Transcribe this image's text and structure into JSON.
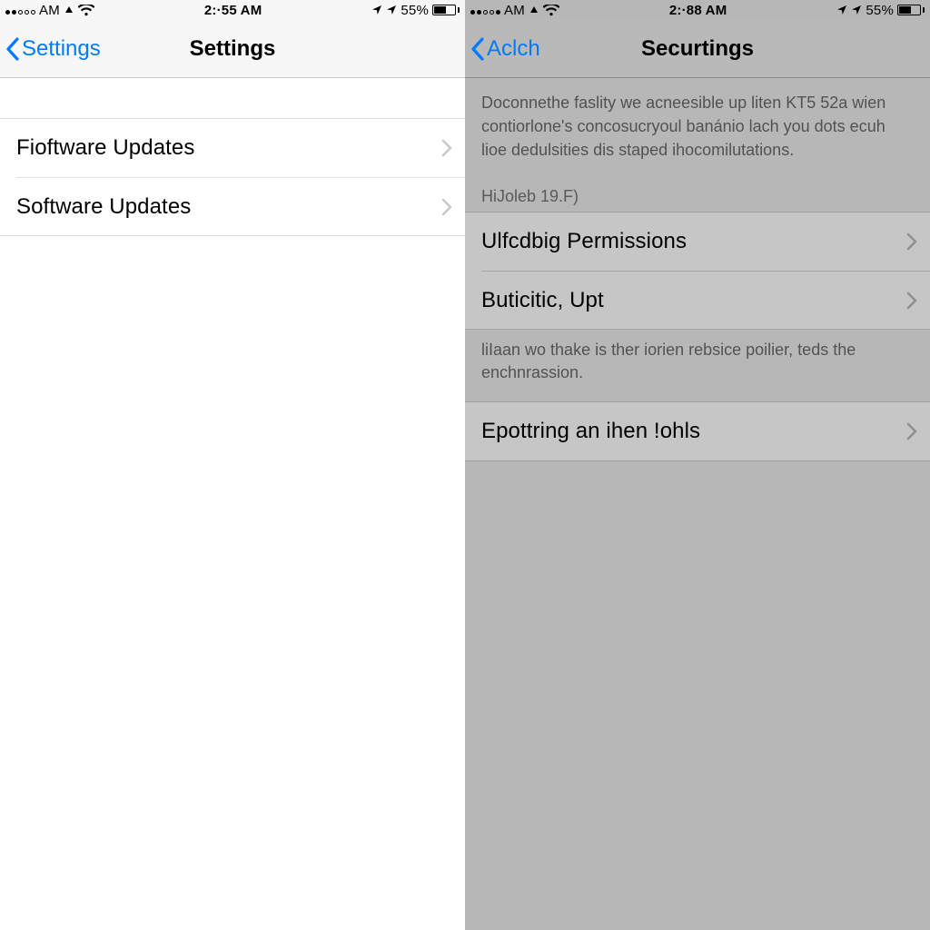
{
  "left": {
    "status": {
      "carrier": "AM",
      "time": "2:·55 AM",
      "battery_text": "55%"
    },
    "nav": {
      "back_label": "Settings",
      "title": "Settings"
    },
    "rows": [
      {
        "label": "Fioftware Updates"
      },
      {
        "label": "Software Updates"
      }
    ]
  },
  "right": {
    "status": {
      "carrier": "AM",
      "time": "2:·88 AM",
      "battery_text": "55%"
    },
    "nav": {
      "back_label": "Aclch",
      "title": "Securtings"
    },
    "description": "Doconnethe faslity we acneesible up liten KT5 52a wien contiorlone's concosucryoul banánio lach you dots ecuh lioe dedulsities dis staped ihocomilutations.",
    "section_header": "HiJoleb 19.F)",
    "rows_group1": [
      {
        "label": "Ulfcdbig Permissions"
      },
      {
        "label": "Buticitic, Upt"
      }
    ],
    "footer_note": "liIaan wo thake is ther iorien rebsice poilier, teds the enchnrassion.",
    "rows_group2": [
      {
        "label": "Epottring an ihen !ohls"
      }
    ]
  }
}
